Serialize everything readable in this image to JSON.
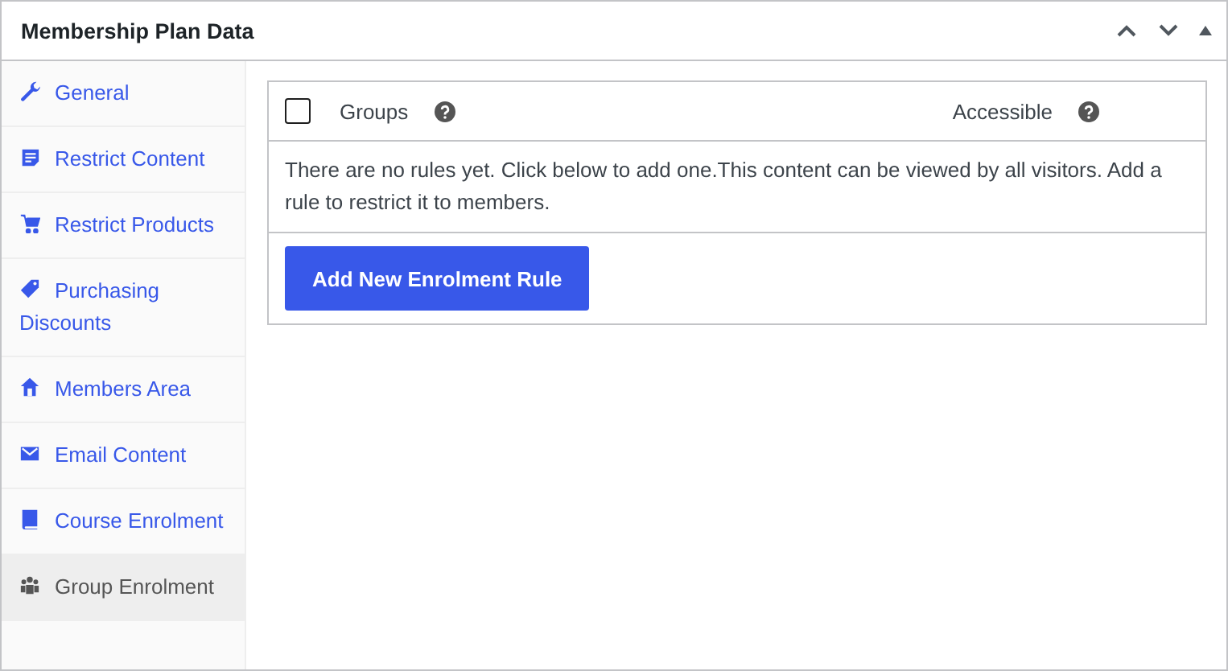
{
  "panel": {
    "title": "Membership Plan Data"
  },
  "sidebar": {
    "items": [
      {
        "label": "General",
        "selected": false
      },
      {
        "label": "Restrict Content",
        "selected": false
      },
      {
        "label": "Restrict Products",
        "selected": false
      },
      {
        "label": "Purchasing Discounts",
        "selected": false
      },
      {
        "label": "Members Area",
        "selected": false
      },
      {
        "label": "Email Content",
        "selected": false
      },
      {
        "label": "Course Enrolment",
        "selected": false
      },
      {
        "label": "Group Enrolment",
        "selected": true
      }
    ]
  },
  "rules_table": {
    "select_all_checked": false,
    "columns": [
      "Groups",
      "Accessible"
    ],
    "empty_message": "There are no rules yet. Click below to add one.This content can be viewed by all visitors. Add a rule to restrict it to members.",
    "add_button": "Add New Enrolment Rule"
  }
}
